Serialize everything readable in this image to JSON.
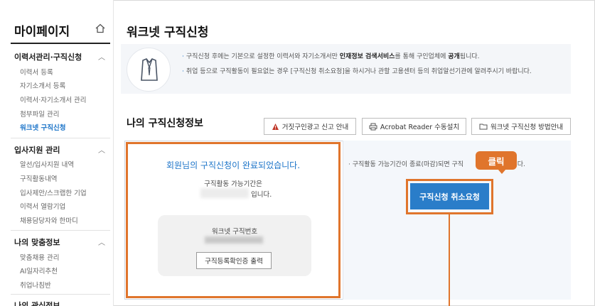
{
  "sidebar": {
    "title": "마이페이지",
    "home_icon": "home-icon",
    "sections": [
      {
        "label": "이력서관리·구직신청",
        "items": [
          "이력서 등록",
          "자기소개서 등록",
          "이력서·자기소개서 관리",
          "첨부파일 관리",
          "워크넷 구직신청"
        ],
        "active_index": 4
      },
      {
        "label": "입사지원 관리",
        "items": [
          "알선/입사지원 내역",
          "구직활동내역",
          "입사제안/스크랩한 기업",
          "이력서 열람기업",
          "채용담당자와 한마디"
        ]
      },
      {
        "label": "나의 맞춤정보",
        "items": [
          "맞춤채용 관리",
          "AI일자리추천",
          "취업나침반"
        ]
      },
      {
        "label": "나의 관심정보",
        "items": []
      }
    ]
  },
  "main": {
    "title": "워크넷 구직신청",
    "info": {
      "icon": "shirt-icon",
      "line1_a": "구직신청 후에는 기본으로 설정한 이력서와 자기소개서만 ",
      "line1_b": "인재정보 검색서비스",
      "line1_c": "를 통해 구인업체에 ",
      "line1_d": "공개",
      "line1_e": "됩니다.",
      "line2": "취업 등으로 구직활동이 필요없는 경우 [구직신청 취소요청]을 하시거나 관할 고용센터 등의 취업알선기관에 알려주시기 바랍니다."
    },
    "status": {
      "title": "나의 구직신청정보",
      "buttons": [
        {
          "label": "거짓구인광고 신고 안내",
          "icon": "alert-icon"
        },
        {
          "label": "Acrobat Reader 수동설치",
          "icon": "printer-icon"
        },
        {
          "label": "워크넷 구직신청 방법안내",
          "icon": "folder-icon"
        }
      ],
      "done_message": "회원님의 구직신청이 완료되었습니다.",
      "period_label": "구직활동 가능기간은",
      "period_suffix": "입니다.",
      "number_label": "워크넷 구직번호",
      "print_button": "구직등록확인증 출력",
      "right_note": "· 구직활동 가능기간이 종료(마감)되면 구직",
      "right_note_tail": "야 합니다.",
      "cancel_button": "구직신청 취소요청",
      "callout": "클릭",
      "accent_color": "#e0752c",
      "primary_color": "#2a7dc9"
    }
  }
}
